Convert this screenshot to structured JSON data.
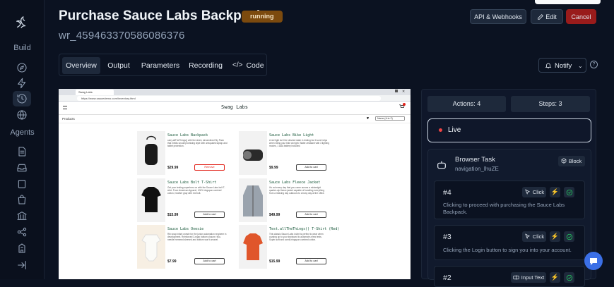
{
  "rail": {
    "build_label": "Build",
    "agents_label": "Agents",
    "icons": [
      "logo-icon",
      "compass-icon",
      "bolt-icon",
      "history-icon",
      "globe-icon",
      "document-icon",
      "inbox-icon",
      "square-icon",
      "bag-icon",
      "bank-icon",
      "share-icon",
      "building-icon",
      "collapse-icon"
    ]
  },
  "header": {
    "title": "Purchase Sauce Labs Backpack",
    "status": "running",
    "run_id": "wr_459463370586086376",
    "api_button": "API & Webhooks",
    "edit_button": "Edit",
    "cancel_button": "Cancel"
  },
  "tabs": [
    "Overview",
    "Output",
    "Parameters",
    "Recording",
    "Code"
  ],
  "active_tab": "Overview",
  "notify_label": "Notify",
  "browser": {
    "tab_title": "Swag Labs",
    "url": "https://www.saucedemo.com/inventory.html",
    "site_title": "Swag Labs",
    "products_label": "Products",
    "sort_label": "Name (A to Z)",
    "products": [
      {
        "name": "Sauce Labs Backpack",
        "desc": "carry.allTheThings() with the sleek, streamlined Sly Pack that melds uncompromising style with unequaled laptop and tablet protection.",
        "price": "$29.99",
        "button": "Remove"
      },
      {
        "name": "Sauce Labs Bike Light",
        "desc": "A red light isn't the desired state in testing but it sure helps when riding your bike at night. Water-resistant with 3 lighting modes, 1 AAA battery included.",
        "price": "$9.99",
        "button": "Add to cart"
      },
      {
        "name": "Sauce Labs Bolt T-Shirt",
        "desc": "Get your testing superhero on with the Sauce Labs bolt T-shirt. From American Apparel, 100% ringspun combed cotton, heather gray with red bolt.",
        "price": "$15.99",
        "button": "Add to cart"
      },
      {
        "name": "Sauce Labs Fleece Jacket",
        "desc": "It's not every day that you come across a midweight quarter-zip fleece jacket capable of handling everything from a relaxing day outdoors to a busy day at the office.",
        "price": "$49.99",
        "button": "Add to cart"
      },
      {
        "name": "Sauce Labs Onesie",
        "desc": "Rib snap infant onesie for the junior automation engineer in development. Reinforced 3-snap bottom closure, two-needle hemmed sleeved and bottom won't unravel.",
        "price": "$7.99",
        "button": "Add to cart"
      },
      {
        "name": "Test.allTheThings() T-Shirt (Red)",
        "desc": "This classic Sauce Labs t-shirt is perfect to wear when cozying up to your keyboard to automate a few tests. Super-soft and comfy ringspun combed cotton.",
        "price": "$15.99",
        "button": "Add to cart"
      }
    ]
  },
  "panel": {
    "actions": "Actions: 4",
    "steps": "Steps: 3",
    "live": "Live",
    "task_title": "Browser Task",
    "task_sub": "navigation_lhuZE",
    "block_button": "Block",
    "items": [
      {
        "num": "#4",
        "action": "Click",
        "desc": "Clicking to proceed with purchasing the Sauce Labs Backpack."
      },
      {
        "num": "#3",
        "action": "Click",
        "desc": "Clicking the Login button to sign you into your account."
      },
      {
        "num": "#2",
        "action": "Input Text",
        "desc": ""
      }
    ]
  },
  "colors": {
    "background": "#0b1221",
    "status": "#7c4a0e",
    "cancel": "#991b1b",
    "live_dot": "#ef4444",
    "bolt": "#facc15",
    "check": "#22c55e"
  }
}
